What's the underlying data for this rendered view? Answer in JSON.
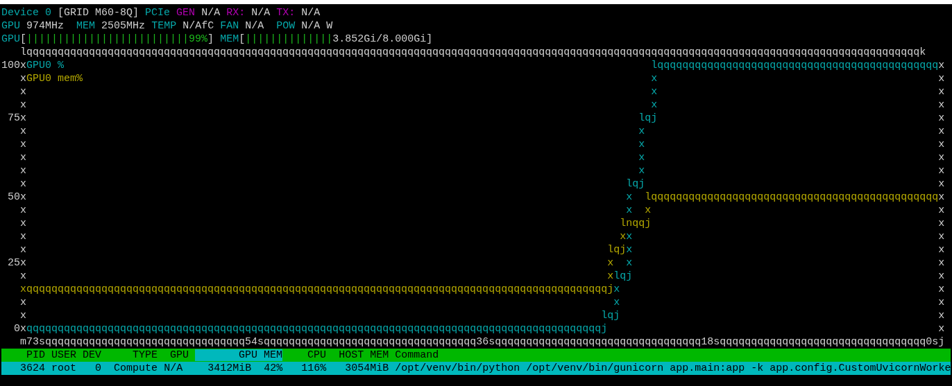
{
  "device_line": [
    {
      "kind": "label",
      "text": "Device 0"
    },
    {
      "kind": "value",
      "text": " [GRID M60-8Q]"
    },
    {
      "kind": "label",
      "text": " PCIe"
    },
    {
      "kind": "alert",
      "text": " GEN"
    },
    {
      "kind": "value",
      "text": " N/A"
    },
    {
      "kind": "alert",
      "text": " RX:"
    },
    {
      "kind": "value",
      "text": " N/A"
    },
    {
      "kind": "alert",
      "text": " TX:"
    },
    {
      "kind": "value",
      "text": " N/A"
    }
  ],
  "clock_line": [
    {
      "kind": "label",
      "text": "GPU"
    },
    {
      "kind": "value",
      "text": " 974MHz"
    },
    {
      "kind": "label",
      "text": "  MEM"
    },
    {
      "kind": "value",
      "text": " 2505MHz"
    },
    {
      "kind": "label",
      "text": " TEMP"
    },
    {
      "kind": "value",
      "text": " N/AfC"
    },
    {
      "kind": "label",
      "text": " FAN"
    },
    {
      "kind": "value",
      "text": " N/A"
    },
    {
      "kind": "label",
      "text": "  POW"
    },
    {
      "kind": "value",
      "text": " N/A W"
    }
  ],
  "usage_line": [
    {
      "kind": "label",
      "text": "GPU"
    },
    {
      "kind": "bracket",
      "text": "["
    },
    {
      "kind": "meter",
      "text": "||||||||||||||||||||||||||"
    },
    {
      "kind": "meter_value",
      "text": "99%"
    },
    {
      "kind": "bracket",
      "text": "]"
    },
    {
      "kind": "label",
      "text": " MEM"
    },
    {
      "kind": "bracket",
      "text": "["
    },
    {
      "kind": "meter",
      "text": "||||||||||||||"
    },
    {
      "kind": "value",
      "text": "3.852Gi/8.000Gi"
    },
    {
      "kind": "bracket",
      "text": "]"
    }
  ],
  "chart_rows": [
    [
      {
        "kind": "frame",
        "text": "   lqqqqqqqqqqqqqqqqqqqqqqqqqqqqqqqqqqqqqqqqqqqqqqqqqqqqqqqqqqqqqqqqqqqqqqqqqqqqqqqqqqqqqqqqqqqqqqqqqqqqqqqqqqqqqqqqqqqqqqqqqqqqqqqqqqqqqqqqqqqqqqqk"
      }
    ],
    [
      {
        "kind": "tick",
        "text": "100"
      },
      {
        "kind": "frame",
        "text": "x"
      },
      {
        "kind": "gpu_legend",
        "text": "GPU0 %"
      },
      {
        "kind": "gpu_series",
        "text": "                                                                                              lqqqqqqqqqqqqqqqqqqqqqqqqqqqqqqqqqqqqqqqqqqqqq"
      },
      {
        "kind": "frame",
        "text": "x"
      }
    ],
    [
      {
        "kind": "frame",
        "text": "   x"
      },
      {
        "kind": "mem_legend",
        "text": "GPU0 mem%"
      },
      {
        "kind": "gpu_series",
        "text": "                                                                                           x"
      },
      {
        "kind": "frame",
        "text": "                                             x"
      }
    ],
    [
      {
        "kind": "frame",
        "text": "   x"
      },
      {
        "kind": "gpu_series",
        "text": "                                                                                                    x"
      },
      {
        "kind": "frame",
        "text": "                                             x"
      }
    ],
    [
      {
        "kind": "frame",
        "text": "   x"
      },
      {
        "kind": "gpu_series",
        "text": "                                                                                                    x"
      },
      {
        "kind": "frame",
        "text": "                                             x"
      }
    ],
    [
      {
        "kind": "tick",
        "text": " 75"
      },
      {
        "kind": "frame",
        "text": "x"
      },
      {
        "kind": "gpu_series",
        "text": "                                                                                                  lqj"
      },
      {
        "kind": "frame",
        "text": "                                             x"
      }
    ],
    [
      {
        "kind": "frame",
        "text": "   x"
      },
      {
        "kind": "gpu_series",
        "text": "                                                                                                  x"
      },
      {
        "kind": "frame",
        "text": "                                               x"
      }
    ],
    [
      {
        "kind": "frame",
        "text": "   x"
      },
      {
        "kind": "gpu_series",
        "text": "                                                                                                  x"
      },
      {
        "kind": "frame",
        "text": "                                               x"
      }
    ],
    [
      {
        "kind": "frame",
        "text": "   x"
      },
      {
        "kind": "gpu_series",
        "text": "                                                                                                  x"
      },
      {
        "kind": "frame",
        "text": "                                               x"
      }
    ],
    [
      {
        "kind": "frame",
        "text": "   x"
      },
      {
        "kind": "gpu_series",
        "text": "                                                                                                  x"
      },
      {
        "kind": "frame",
        "text": "                                               x"
      }
    ],
    [
      {
        "kind": "frame",
        "text": "   x"
      },
      {
        "kind": "gpu_series",
        "text": "                                                                                                lqj"
      },
      {
        "kind": "frame",
        "text": "                                               x"
      }
    ],
    [
      {
        "kind": "tick",
        "text": " 50"
      },
      {
        "kind": "frame",
        "text": "x"
      },
      {
        "kind": "gpu_series",
        "text": "                                                                                                x"
      },
      {
        "kind": "mem_series",
        "text": "  lqqqqqqqqqqqqqqqqqqqqqqqqqqqqqqqqqqqqqqqqqqqqqq"
      },
      {
        "kind": "frame",
        "text": "x"
      }
    ],
    [
      {
        "kind": "frame",
        "text": "   x"
      },
      {
        "kind": "gpu_series",
        "text": "                                                                                                x"
      },
      {
        "kind": "mem_series",
        "text": "  x"
      },
      {
        "kind": "frame",
        "text": "                                              x"
      }
    ],
    [
      {
        "kind": "frame",
        "text": "   x"
      },
      {
        "kind": "mem_series",
        "text": "                                                                                               lnqqj"
      },
      {
        "kind": "frame",
        "text": "                                              x"
      }
    ],
    [
      {
        "kind": "frame",
        "text": "   x"
      },
      {
        "kind": "mem_series",
        "text": "                                                                                               x"
      },
      {
        "kind": "gpu_series",
        "text": "x"
      },
      {
        "kind": "frame",
        "text": "                                                 x"
      }
    ],
    [
      {
        "kind": "frame",
        "text": "   x"
      },
      {
        "kind": "mem_series",
        "text": "                                                                                             lqj"
      },
      {
        "kind": "gpu_series",
        "text": "x"
      },
      {
        "kind": "frame",
        "text": "                                                 x"
      }
    ],
    [
      {
        "kind": "tick",
        "text": " 25"
      },
      {
        "kind": "frame",
        "text": "x"
      },
      {
        "kind": "mem_series",
        "text": "                                                                                             x"
      },
      {
        "kind": "gpu_series",
        "text": "  x"
      },
      {
        "kind": "frame",
        "text": "                                                 x"
      }
    ],
    [
      {
        "kind": "frame",
        "text": "   x"
      },
      {
        "kind": "mem_series",
        "text": "                                                                                             x"
      },
      {
        "kind": "gpu_series",
        "text": "lqj"
      },
      {
        "kind": "frame",
        "text": "                                                 x"
      }
    ],
    [
      {
        "kind": "mem_series",
        "text": "   xqqqqqqqqqqqqqqqqqqqqqqqqqqqqqqqqqqqqqqqqqqqqqqqqqqqqqqqqqqqqqqqqqqqqqqqqqqqqqqqqqqqqqqqqqqqqqj"
      },
      {
        "kind": "gpu_series",
        "text": "x"
      },
      {
        "kind": "frame",
        "text": "                                                   x"
      }
    ],
    [
      {
        "kind": "frame",
        "text": "   x"
      },
      {
        "kind": "gpu_series",
        "text": "                                                                                              x"
      },
      {
        "kind": "frame",
        "text": "                                                   x"
      }
    ],
    [
      {
        "kind": "frame",
        "text": "   x"
      },
      {
        "kind": "gpu_series",
        "text": "                                                                                            lqj"
      },
      {
        "kind": "frame",
        "text": "                                                   x"
      }
    ],
    [
      {
        "kind": "tick",
        "text": "  0"
      },
      {
        "kind": "frame",
        "text": "x"
      },
      {
        "kind": "gpu_series",
        "text": "qqqqqqqqqqqqqqqqqqqqqqqqqqqqqqqqqqqqqqqqqqqqqqqqqqqqqqqqqqqqqqqqqqqqqqqqqqqqqqqqqqqqqqqqqqqqj"
      },
      {
        "kind": "frame",
        "text": "                                                     x"
      }
    ],
    [
      {
        "kind": "frame",
        "text": "   m"
      },
      {
        "kind": "tick",
        "text": "73s"
      },
      {
        "kind": "frame",
        "text": "qqqqqqqqqqqqqqqqqqqqqqqqqqqqqqqq"
      },
      {
        "kind": "tick",
        "text": "54s"
      },
      {
        "kind": "frame",
        "text": "qqqqqqqqqqqqqqqqqqqqqqqqqqqqqqqqqq"
      },
      {
        "kind": "tick",
        "text": "36s"
      },
      {
        "kind": "frame",
        "text": "qqqqqqqqqqqqqqqqqqqqqqqqqqqqqqqqq"
      },
      {
        "kind": "tick",
        "text": "18s"
      },
      {
        "kind": "frame",
        "text": "qqqqqqqqqqqqqqqqqqqqqqqqqqqqqqqqq"
      },
      {
        "kind": "tick",
        "text": "0s"
      },
      {
        "kind": "frame",
        "text": "j"
      }
    ]
  ],
  "process_table": {
    "columns": [
      {
        "text": "    PID",
        "selected": false
      },
      {
        "text": " USER",
        "selected": false
      },
      {
        "text": " DEV",
        "selected": false
      },
      {
        "text": "     TYPE",
        "selected": false
      },
      {
        "text": "  GPU ",
        "selected": false
      },
      {
        "text": "       GPU MEM",
        "selected": true
      },
      {
        "text": "    CPU",
        "selected": false
      },
      {
        "text": "  HOST MEM",
        "selected": false
      },
      {
        "text": " Command",
        "selected": false
      }
    ],
    "rows": [
      {
        "selected": true,
        "cells": [
          "   3624",
          " root",
          "   0",
          "  Compute",
          " N/A",
          "    3412MiB  42%",
          "   116%",
          "   3054MiB",
          " /opt/venv/bin/python /opt/venv/bin/gunicorn app.main:app -k app.config.CustomUvicornWorke"
        ]
      }
    ]
  }
}
